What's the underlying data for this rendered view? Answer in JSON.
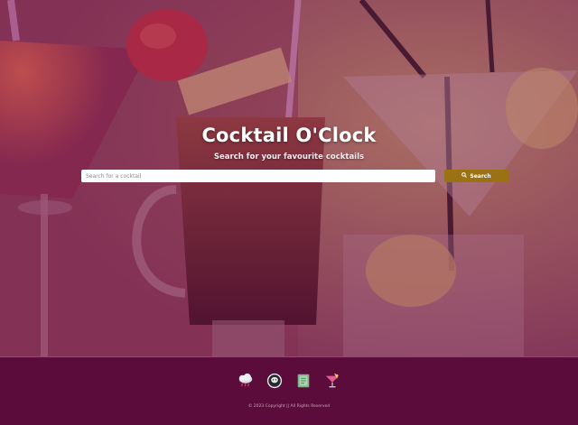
{
  "hero": {
    "title": "Cocktail O'Clock",
    "subtitle": "Search for your favourite cocktails",
    "search": {
      "placeholder": "Search for a cocktail",
      "value": "",
      "button_label": "Search",
      "button_icon": "search-icon"
    },
    "background": "cocktail-glasses-photo",
    "tint_color": "#781e50"
  },
  "footer": {
    "social_icons": [
      {
        "name": "cloud-rain-icon",
        "label": ""
      },
      {
        "name": "github-icon",
        "label": ""
      },
      {
        "name": "book-icon",
        "label": ""
      },
      {
        "name": "cocktail-glass-icon",
        "label": ""
      }
    ],
    "copyright": "© 2023 Copyright || All Rights Reserved",
    "background_color": "#5b0c3b",
    "accent_color": "#9a7213"
  }
}
